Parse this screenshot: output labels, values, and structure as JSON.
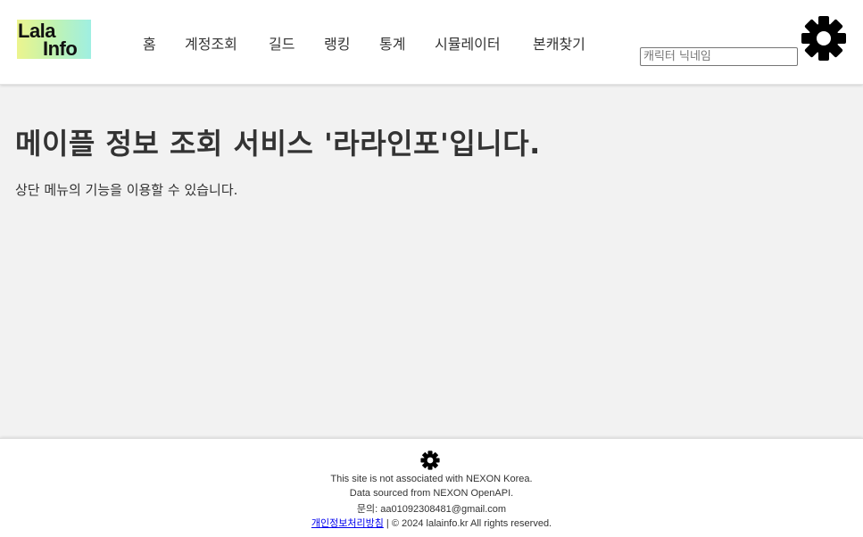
{
  "header": {
    "logo": {
      "line1": "Lala",
      "line2": "Info"
    },
    "nav": [
      {
        "label": "홈"
      },
      {
        "label": "계정조회"
      },
      {
        "label": "길드"
      },
      {
        "label": "랭킹"
      },
      {
        "label": "통계"
      },
      {
        "label": "시뮬레이터"
      },
      {
        "label": "본캐찾기"
      }
    ],
    "search": {
      "placeholder": "캐릭터 닉네임",
      "value": ""
    },
    "settings_icon": "gear-icon"
  },
  "main": {
    "title": "메이플 정보 조회 서비스 '라라인포'입니다.",
    "description": "상단 메뉴의 기능을 이용할 수 있습니다."
  },
  "footer": {
    "settings_icon": "gear-icon",
    "disclaimer": "This site is not associated with NEXON Korea.",
    "source": "Data sourced from NEXON OpenAPI.",
    "contact": "문의: aa01092308481@gmail.com",
    "privacy_link": "개인정보처리방침",
    "copyright": " | © 2024 lalainfo.kr All rights reserved."
  },
  "colors": {
    "page_bg": "#f2f2f2",
    "header_bg": "#ffffff",
    "logo_gradient": [
      "#ecf48e",
      "#9fefe2"
    ],
    "text": "#333333",
    "link": "#0000ee"
  }
}
